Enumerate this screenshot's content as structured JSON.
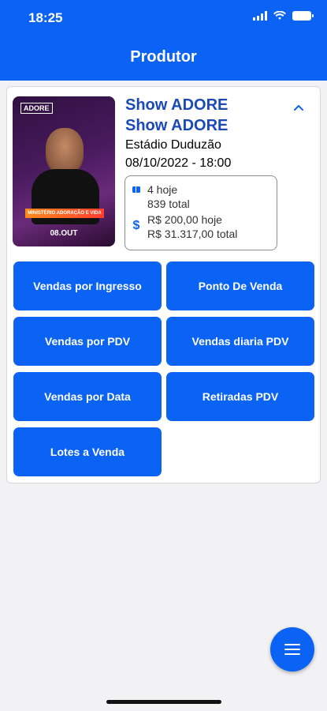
{
  "status_bar": {
    "time": "18:25"
  },
  "header": {
    "title": "Produtor"
  },
  "event": {
    "name_line1": "Show ADORE",
    "name_line2": "Show ADORE",
    "venue": "Estádio Duduzão",
    "datetime": "08/10/2022 - 18:00",
    "poster": {
      "logo": "ADORE",
      "banner": "MINISTÉRIO ADORAÇÃO E VIDA",
      "date": "08.OUT"
    },
    "stats": {
      "tickets_today": "4 hoje",
      "tickets_total": "839 total",
      "revenue_today": "R$ 200,00 hoje",
      "revenue_total": "R$ 31.317,00 total"
    }
  },
  "buttons": [
    "Vendas por Ingresso",
    "Ponto De Venda",
    "Vendas por PDV",
    "Vendas diaria PDV",
    "Vendas por Data",
    "Retiradas PDV",
    "Lotes a Venda"
  ],
  "icons": {
    "collapse": "chevron-up-icon",
    "tickets": "ticket-icon",
    "money": "dollar-icon",
    "fab": "menu-icon"
  },
  "colors": {
    "primary": "#0a63f5",
    "title": "#1b49b8"
  }
}
